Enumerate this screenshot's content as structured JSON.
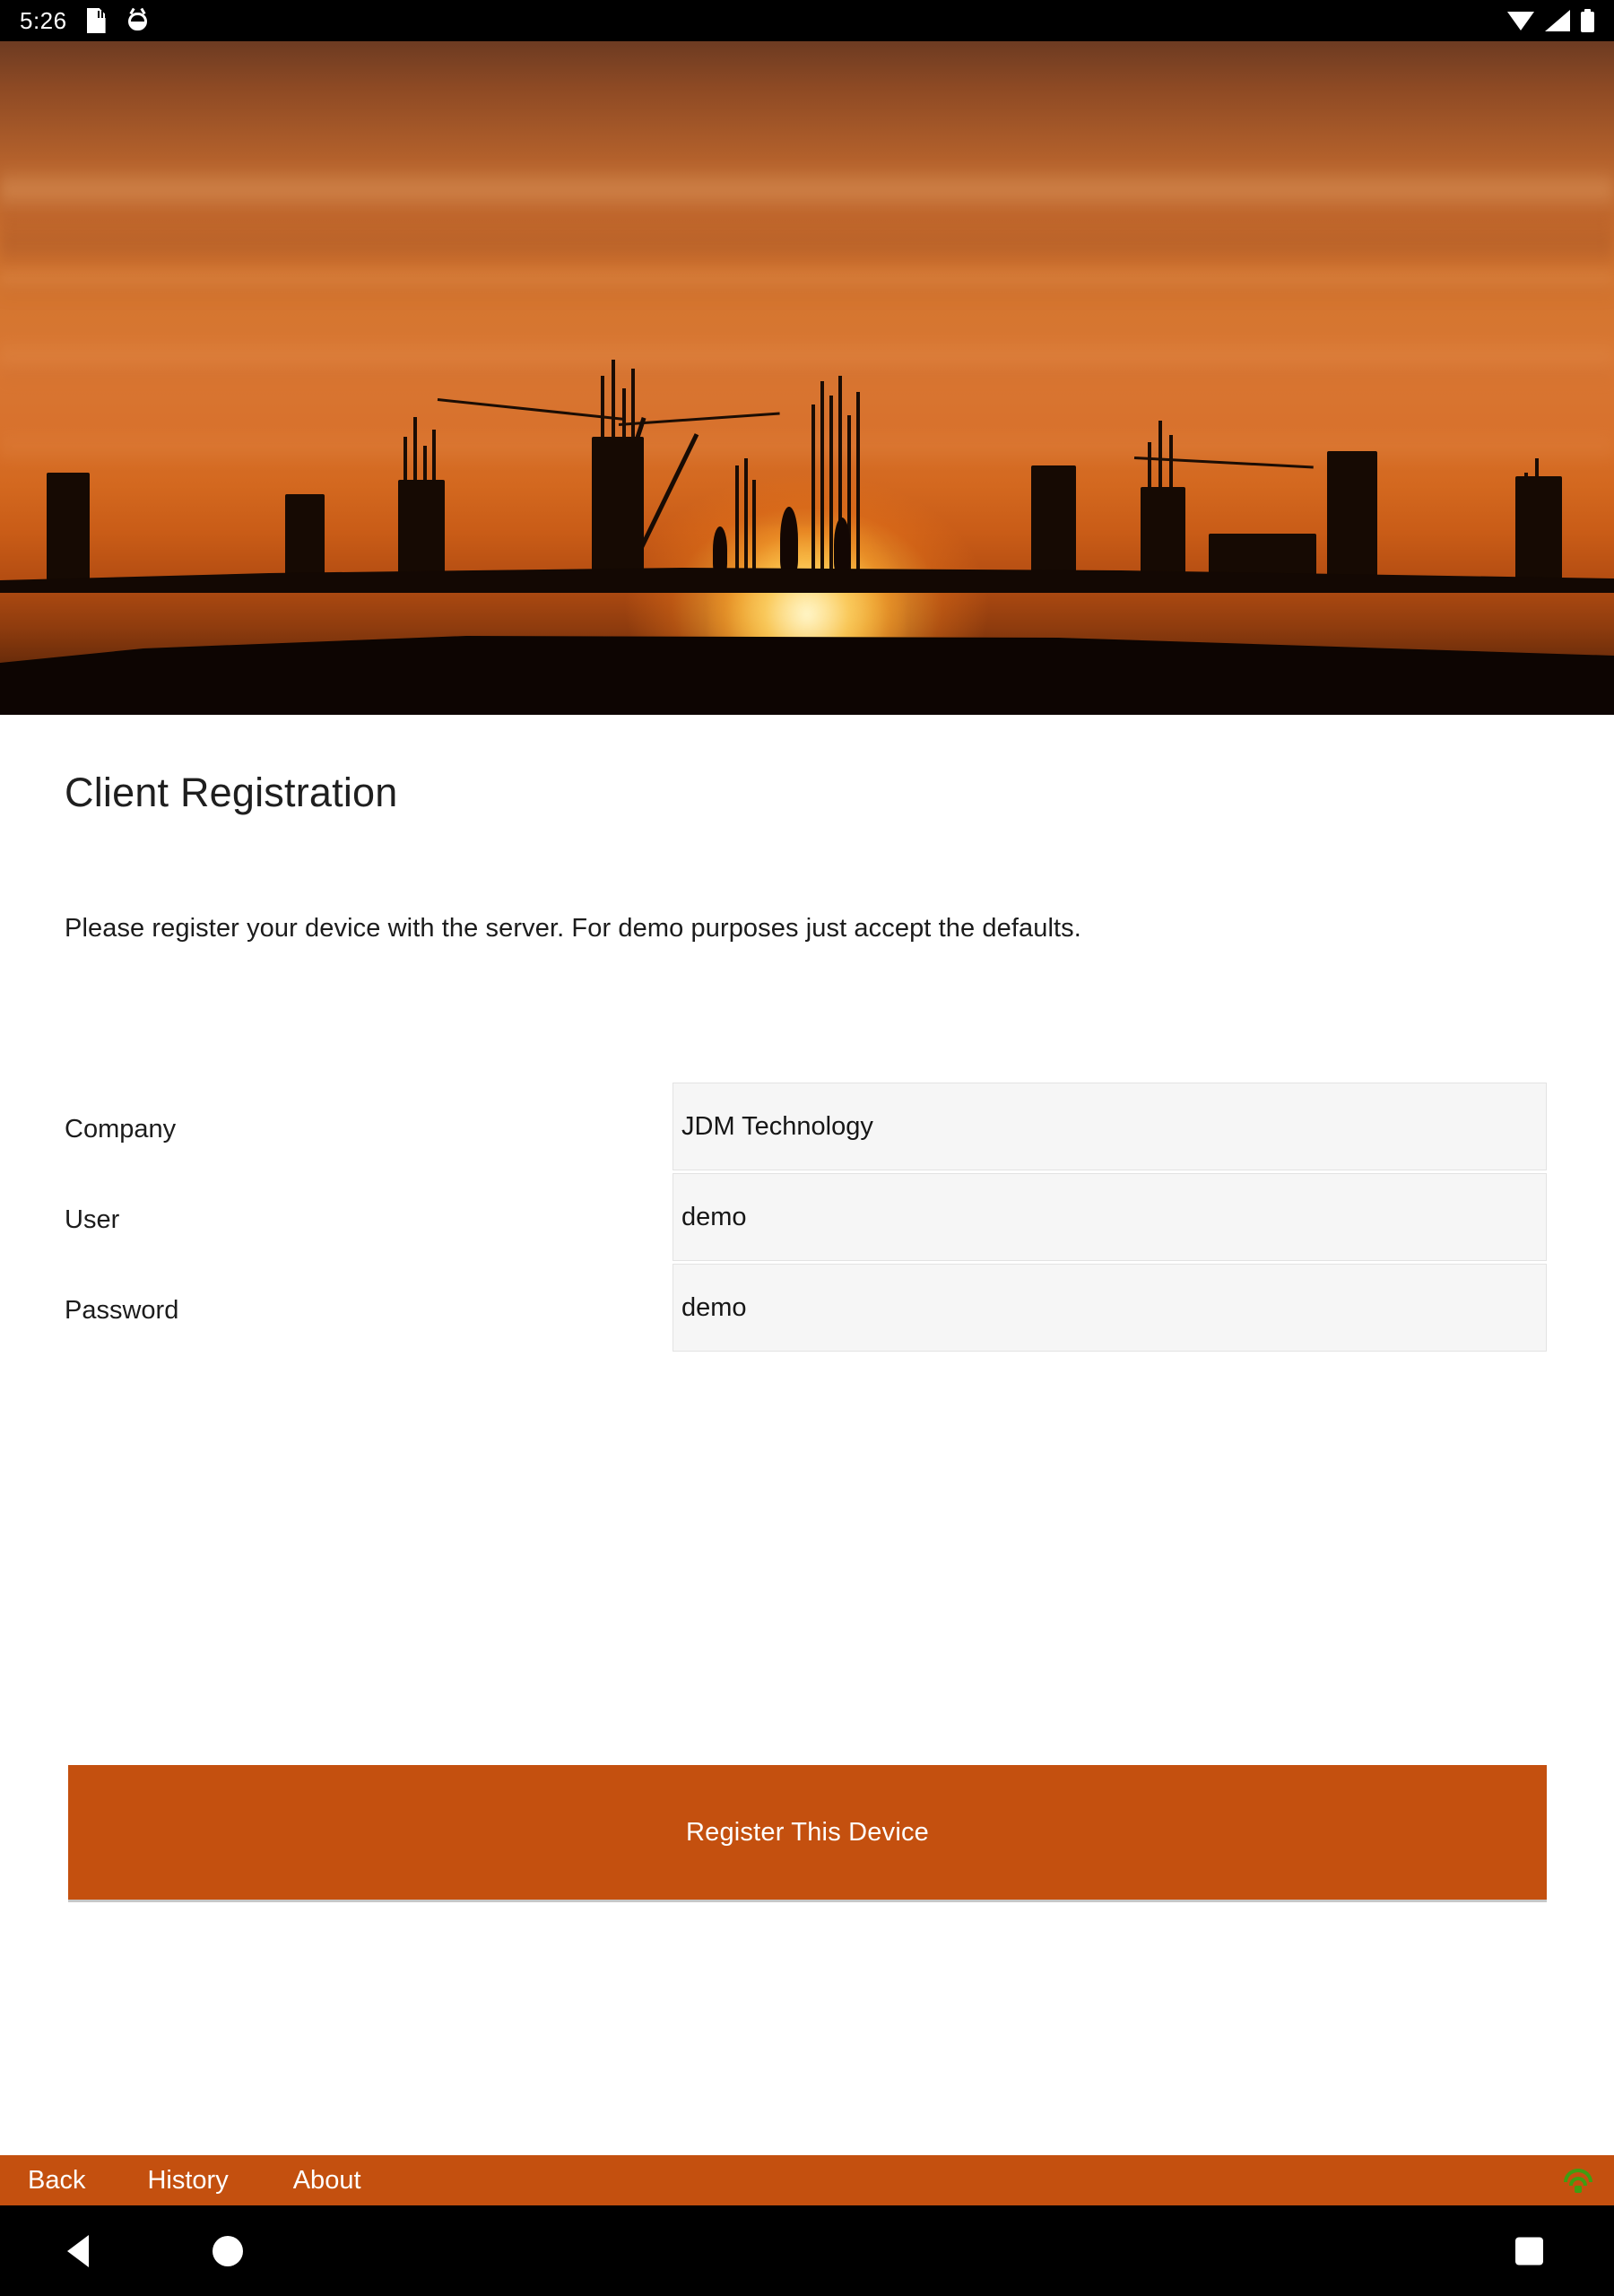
{
  "statusbar": {
    "clock": "5:26",
    "left_icons": [
      "sdcard-icon",
      "android-debug-icon"
    ],
    "right_icons": [
      "wifi-icon",
      "cell-signal-icon",
      "battery-icon"
    ]
  },
  "hero": {
    "alt": "Construction site silhouette at sunset with rebar columns and workers"
  },
  "page": {
    "title": "Client Registration",
    "description": "Please register your device with the server. For demo purposes just accept the defaults."
  },
  "form": {
    "fields": [
      {
        "label": "Company",
        "value": "JDM Technology",
        "placeholder": "Company"
      },
      {
        "label": "User",
        "value": "demo",
        "placeholder": "User"
      },
      {
        "label": "Password",
        "value": "demo",
        "placeholder": "Password"
      }
    ]
  },
  "primary_action": {
    "label": "Register This Device"
  },
  "appbar": {
    "items": [
      {
        "label": "Back"
      },
      {
        "label": "History"
      },
      {
        "label": "About"
      }
    ],
    "status_icon": "wifi-connected-icon"
  },
  "navbar": {
    "back": "back-triangle-icon",
    "home": "home-circle-icon",
    "recents": "recents-square-icon"
  },
  "colors": {
    "accent": "#C4500F",
    "field_bg": "#F6F6F6",
    "field_border": "#E3E3E3",
    "text": "#1C1C1C",
    "status_icon_green": "#3F9E12"
  }
}
